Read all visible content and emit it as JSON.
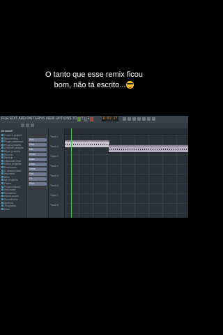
{
  "caption": {
    "line1": "O tanto que esse remix ficou",
    "line2": "bom, não tá escrito...",
    "emoji": "sunglasses-face-emoji"
  },
  "daw": {
    "menu": "FILE EDIT ADD PATTERNS VIEW OPTIONS TOOLS HELP",
    "sub": "Playlist",
    "lcd": "0:01:27",
    "browser_header": "Browser",
    "browser_items": [
      "Current project",
      "Recent files",
      "Plugin database",
      "Plugin presets",
      "Channel presets",
      "Mixer presets",
      "Scores",
      "Backup",
      "Clipboard files",
      "Demo projects",
      "Envelopes",
      "IL shared data",
      "Impulses",
      "Misc",
      "My projects",
      "Packs",
      "Project bones",
      "Recorded",
      "Rendered",
      "Sliced audio",
      "Soundfonts",
      "Speech",
      "Templates",
      "User"
    ],
    "channels": [
      "Kick",
      "Clap",
      "Hat",
      "Snare",
      "Bass",
      "Lead",
      "Vocal",
      "Pad",
      "FX",
      "Perc"
    ],
    "tracks": [
      "Track 1",
      "Track 2",
      "Track 3",
      "Track 4",
      "Track 5",
      "Track 6",
      "Track 7",
      "Track 8"
    ],
    "clips": [
      "Vocal remix",
      "Beat"
    ]
  }
}
